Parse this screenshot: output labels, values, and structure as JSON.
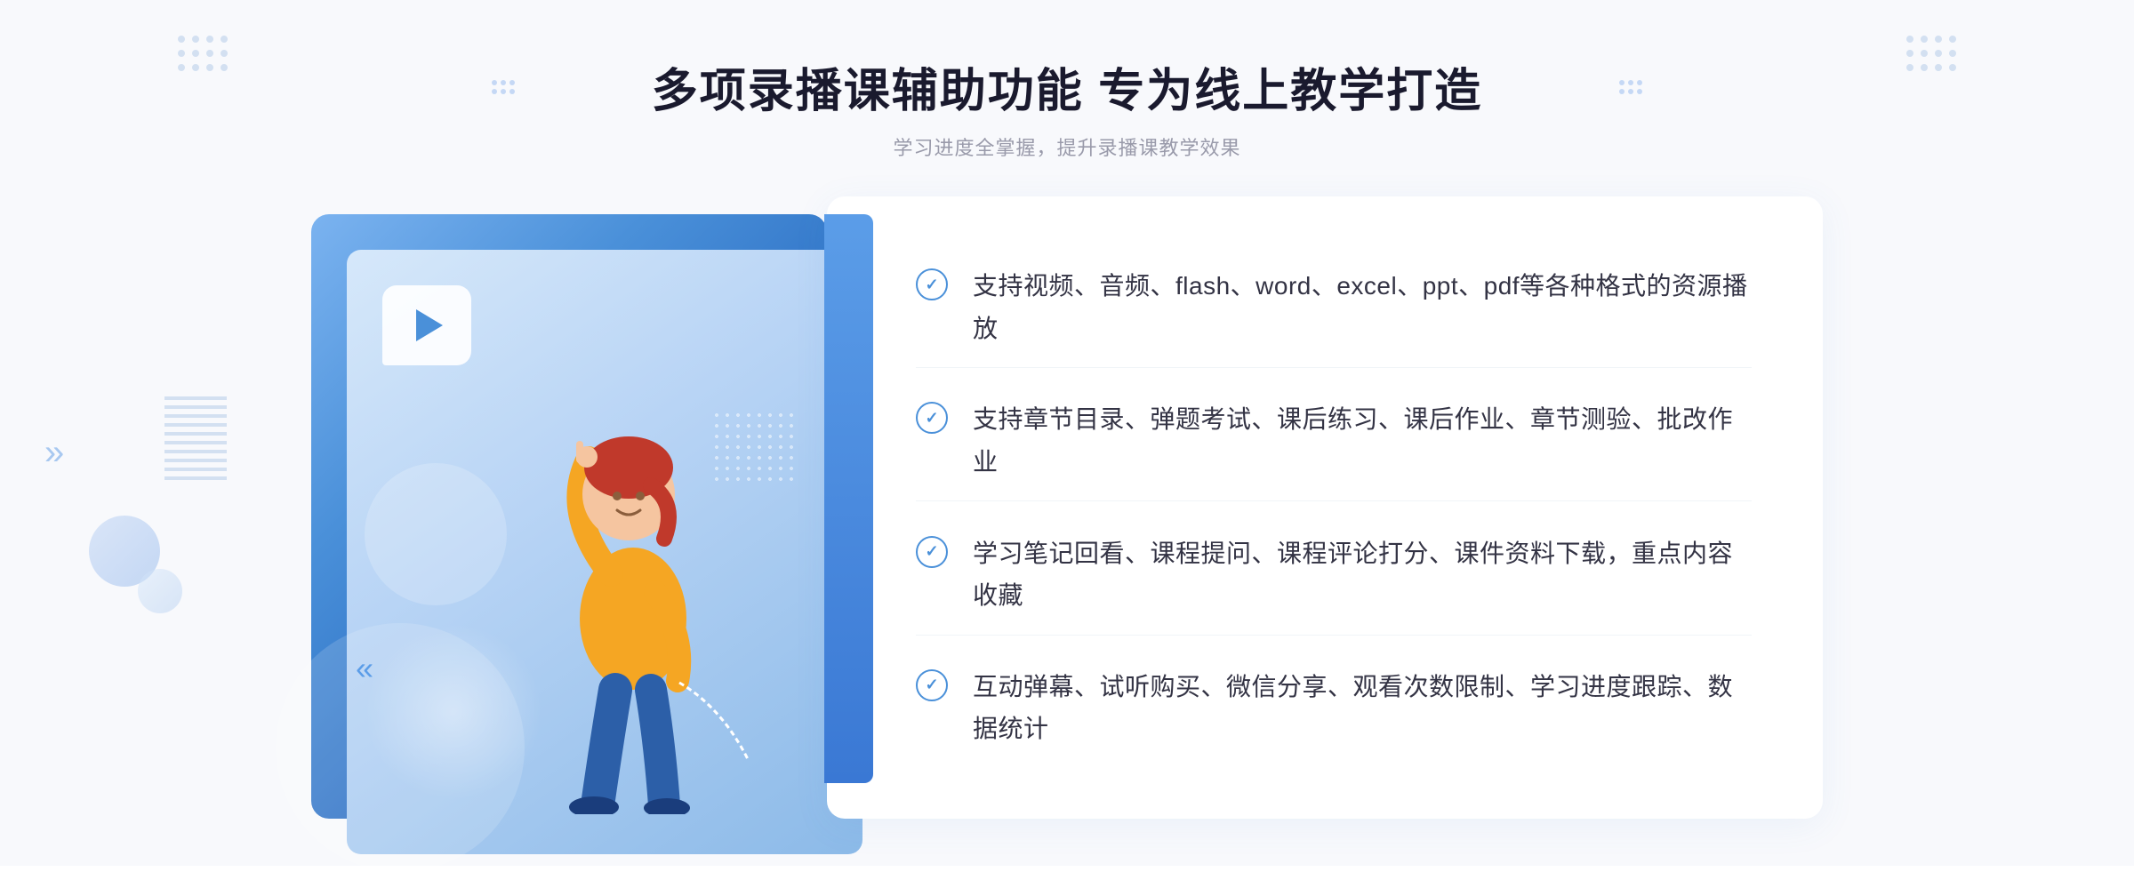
{
  "header": {
    "title": "多项录播课辅助功能 专为线上教学打造",
    "subtitle": "学习进度全掌握，提升录播课教学效果"
  },
  "features": [
    {
      "id": "feature-1",
      "text": "支持视频、音频、flash、word、excel、ppt、pdf等各种格式的资源播放"
    },
    {
      "id": "feature-2",
      "text": "支持章节目录、弹题考试、课后练习、课后作业、章节测验、批改作业"
    },
    {
      "id": "feature-3",
      "text": "学习笔记回看、课程提问、课程评论打分、课件资料下载，重点内容收藏"
    },
    {
      "id": "feature-4",
      "text": "互动弹幕、试听购买、微信分享、观看次数限制、学习进度跟踪、数据统计"
    }
  ],
  "decorations": {
    "chevron": "»",
    "check_symbol": "✓"
  }
}
